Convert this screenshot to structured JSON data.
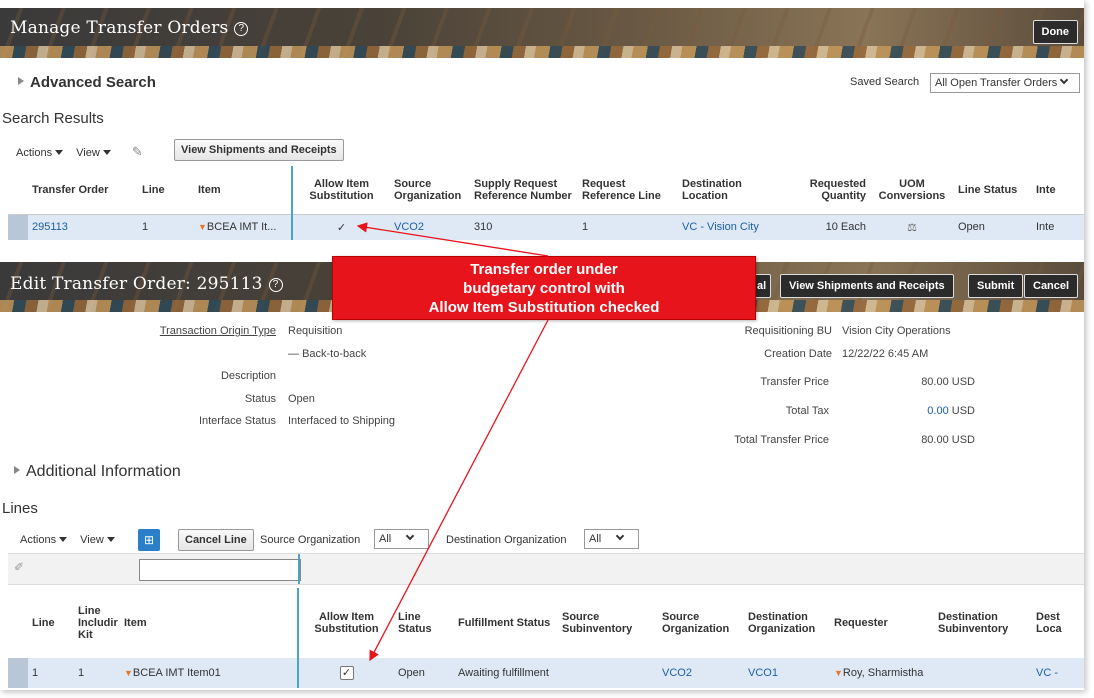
{
  "top": {
    "title": "Manage Transfer Orders",
    "help": "?",
    "done_label": "Done",
    "advanced_search": "Advanced Search",
    "saved_search_label": "Saved Search",
    "saved_search_value": "All Open Transfer Orders",
    "search_results": "Search Results",
    "actions": "Actions",
    "view": "View",
    "view_shipments_btn": "View Shipments and Receipts",
    "columns": [
      "Transfer Order",
      "Line",
      "Item",
      "Allow Item Substitution",
      "Source Organization",
      "Supply Request Reference Number",
      "Request Reference Line",
      "Destination Location",
      "Requested Quantity",
      "UOM Conversions",
      "Line Status",
      "Inte"
    ],
    "row": {
      "transfer_order": "295113",
      "line": "1",
      "item": "BCEA IMT It...",
      "allow_sub": "✓",
      "source_org": "VCO2",
      "supply_ref": "310",
      "req_ref_line": "1",
      "dest_location": "VC - Vision City",
      "qty": "10 Each",
      "line_status": "Open",
      "inte": "Inte"
    }
  },
  "callout": {
    "line1": "Transfer order under",
    "line2": "budgetary control with",
    "line3": "Allow Item Substitution checked"
  },
  "edit": {
    "title": "Edit Transfer Order: 295113",
    "help": "?",
    "partial_btn": "al",
    "view_shipments_btn": "View Shipments and Receipts",
    "submit_btn": "Submit",
    "cancel_btn": "Cancel",
    "fields": {
      "origin_type_label": "Transaction Origin Type",
      "origin_type_value": "Requisition",
      "back_to_back": "Back-to-back",
      "description_label": "Description",
      "status_label": "Status",
      "status_value": "Open",
      "interface_label": "Interface Status",
      "interface_value": "Interfaced to Shipping",
      "req_bu_label": "Requisitioning BU",
      "req_bu_value": "Vision City Operations",
      "creation_label": "Creation Date",
      "creation_value": "12/22/22 6:45 AM",
      "transfer_price_label": "Transfer Price",
      "transfer_price_value": "80.00 USD",
      "total_tax_label": "Total Tax",
      "total_tax_amount": "0.00",
      "total_tax_currency": "USD",
      "total_transfer_label": "Total Transfer Price",
      "total_transfer_value": "80.00 USD"
    },
    "additional_info": "Additional Information",
    "lines": "Lines",
    "actions": "Actions",
    "view": "View",
    "cancel_line_btn": "Cancel Line",
    "source_org_label": "Source Organization",
    "source_org_value": "All",
    "dest_org_label": "Destination Organization",
    "dest_org_value": "All",
    "columns": [
      "Line",
      "Line Includir Kit",
      "Item",
      "Allow Item Substitution",
      "Line Status",
      "Fulfillment Status",
      "Source Subinventory",
      "Source Organization",
      "Destination Organization",
      "Requester",
      "Destination Subinventory",
      "Dest Loca"
    ],
    "row": {
      "line": "1",
      "line_incl": "1",
      "item": "BCEA IMT Item01",
      "allow_sub": "✓",
      "line_status": "Open",
      "fulfillment": "Awaiting fulfillment",
      "source_org": "VCO2",
      "dest_org": "VCO1",
      "requester": "Roy, Sharmistha",
      "dest_loc": "VC -"
    }
  }
}
